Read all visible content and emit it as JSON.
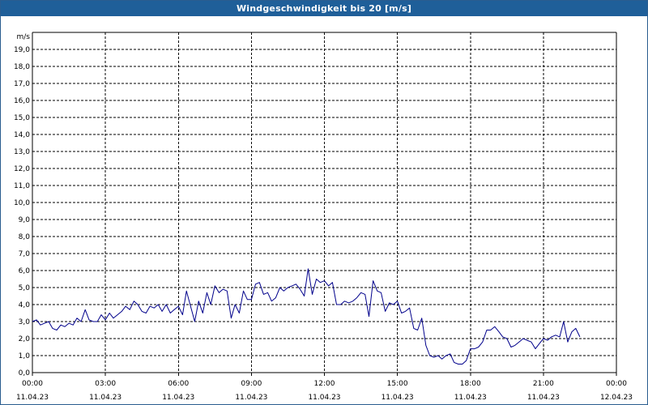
{
  "window": {
    "title": "Windgeschwindigkeit bis 20 [m/s]"
  },
  "chart_data": {
    "type": "line",
    "title": "Windgeschwindigkeit bis 20 [m/s]",
    "ylabel": "m/s",
    "xlabel": "",
    "ylim": [
      0,
      20
    ],
    "xlim_hours": [
      0,
      24
    ],
    "grid": true,
    "y_ticks": [
      "0,0",
      "1,0",
      "2,0",
      "3,0",
      "4,0",
      "5,0",
      "6,0",
      "7,0",
      "8,0",
      "9,0",
      "10,0",
      "11,0",
      "12,0",
      "13,0",
      "14,0",
      "15,0",
      "16,0",
      "17,0",
      "18,0",
      "19,0"
    ],
    "x_ticks": [
      {
        "time": "00:00",
        "date": "11.04.23"
      },
      {
        "time": "03:00",
        "date": "11.04.23"
      },
      {
        "time": "06:00",
        "date": "11.04.23"
      },
      {
        "time": "09:00",
        "date": "11.04.23"
      },
      {
        "time": "12:00",
        "date": "11.04.23"
      },
      {
        "time": "15:00",
        "date": "11.04.23"
      },
      {
        "time": "18:00",
        "date": "11.04.23"
      },
      {
        "time": "21:00",
        "date": "11.04.23"
      },
      {
        "time": "00:00",
        "date": "12.04.23"
      }
    ],
    "series": [
      {
        "color": "#00008b",
        "x_hours": [
          0.0,
          0.17,
          0.33,
          0.5,
          0.67,
          0.83,
          1.0,
          1.17,
          1.33,
          1.5,
          1.67,
          1.83,
          2.0,
          2.17,
          2.33,
          2.5,
          2.67,
          2.83,
          3.0,
          3.17,
          3.33,
          3.5,
          3.67,
          3.83,
          4.0,
          4.17,
          4.33,
          4.5,
          4.67,
          4.83,
          5.0,
          5.17,
          5.33,
          5.5,
          5.67,
          5.83,
          6.0,
          6.17,
          6.33,
          6.5,
          6.67,
          6.83,
          7.0,
          7.17,
          7.33,
          7.5,
          7.67,
          7.83,
          8.0,
          8.17,
          8.33,
          8.5,
          8.67,
          8.83,
          9.0,
          9.17,
          9.33,
          9.5,
          9.67,
          9.83,
          10.0,
          10.17,
          10.33,
          10.5,
          10.67,
          10.83,
          11.0,
          11.17,
          11.33,
          11.5,
          11.67,
          11.83,
          12.0,
          12.17,
          12.33,
          12.5,
          12.67,
          12.83,
          13.0,
          13.17,
          13.33,
          13.5,
          13.67,
          13.83,
          14.0,
          14.17,
          14.33,
          14.5,
          14.67,
          14.83,
          15.0,
          15.17,
          15.33,
          15.5,
          15.67,
          15.83,
          16.0,
          16.17,
          16.33,
          16.5,
          16.67,
          16.83,
          17.0,
          17.17,
          17.33,
          17.5,
          17.67,
          17.83,
          18.0,
          18.17,
          18.33,
          18.5,
          18.67,
          18.83,
          19.0,
          19.17,
          19.33,
          19.5,
          19.67,
          19.83,
          20.0,
          20.17,
          20.33,
          20.5,
          20.67,
          20.83,
          21.0,
          21.17,
          21.33,
          21.5,
          21.67,
          21.83,
          22.0,
          22.17,
          22.33,
          22.5,
          22.67,
          22.83,
          23.0,
          23.17,
          23.33,
          23.5,
          23.67,
          23.83
        ],
        "values": [
          3.0,
          3.1,
          2.8,
          2.9,
          3.0,
          2.6,
          2.5,
          2.8,
          2.7,
          2.9,
          2.8,
          3.2,
          3.0,
          3.7,
          3.1,
          3.0,
          3.0,
          3.4,
          3.1,
          3.5,
          3.2,
          3.4,
          3.6,
          3.9,
          3.7,
          4.2,
          4.0,
          3.6,
          3.5,
          3.9,
          3.8,
          4.0,
          3.6,
          4.0,
          3.5,
          3.7,
          3.9,
          3.4,
          4.8,
          3.9,
          3.0,
          4.2,
          3.5,
          4.7,
          4.0,
          5.1,
          4.7,
          4.9,
          4.8,
          3.2,
          4.0,
          3.5,
          4.8,
          4.3,
          4.3,
          5.2,
          5.3,
          4.6,
          4.7,
          4.2,
          4.4,
          5.0,
          4.8,
          5.0,
          5.1,
          5.2,
          4.9,
          4.5,
          6.1,
          4.6,
          5.5,
          5.3,
          5.4,
          5.1,
          5.3,
          4.0,
          4.0,
          4.2,
          4.1,
          4.2,
          4.4,
          4.7,
          4.6,
          3.3,
          5.4,
          4.8,
          4.7,
          3.6,
          4.1,
          4.0,
          4.2,
          3.5,
          3.6,
          3.8,
          2.6,
          2.5,
          3.2,
          1.6,
          1.0,
          0.9,
          1.0,
          0.8,
          1.0,
          1.1,
          0.6,
          0.5,
          0.5,
          0.7,
          1.4,
          1.4,
          1.5,
          1.8,
          2.5,
          2.5,
          2.7,
          2.4,
          2.1,
          2.0,
          1.5,
          1.6,
          1.8,
          2.0,
          1.9,
          1.8,
          1.4,
          1.7,
          2.0,
          1.9,
          2.1,
          2.2,
          2.1,
          3.0,
          1.8,
          2.4,
          2.6,
          2.1
        ]
      }
    ]
  }
}
